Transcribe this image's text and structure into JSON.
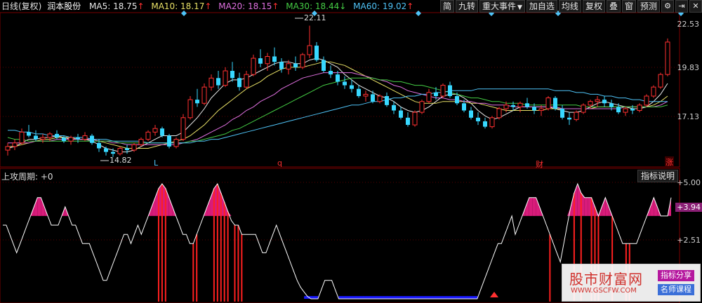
{
  "header": {
    "period_label": "日线(复权)",
    "stock_name": "润本股份",
    "ma": [
      {
        "label": "MA5: 18.75",
        "arrow": "↑",
        "color": "#e8e8e8",
        "arrow_color": "#ff3030"
      },
      {
        "label": "MA10: 18.17",
        "arrow": "↑",
        "color": "#e8e066",
        "arrow_color": "#ff3030"
      },
      {
        "label": "MA20: 18.15",
        "arrow": "↑",
        "color": "#e070e0",
        "arrow_color": "#ff3030"
      },
      {
        "label": "MA30: 18.44",
        "arrow": "↓",
        "color": "#44cc44",
        "arrow_color": "#44cc44"
      },
      {
        "label": "MA60: 19.02",
        "arrow": "↑",
        "color": "#4fc3f7",
        "arrow_color": "#ff3030"
      }
    ]
  },
  "toolbar": {
    "buttons": [
      "简",
      "九转",
      "重大事件",
      "加自选",
      "均线",
      "复权",
      "叠",
      "窗",
      "预测"
    ],
    "dropdown_arrow": "▼",
    "icons": [
      "gear-icon",
      "pin-icon",
      "close-icon"
    ],
    "icon_glyphs": [
      "⚙",
      "⇥",
      "✕"
    ]
  },
  "price_axis": {
    "labels": [
      "22.53",
      "19.83",
      "17.13"
    ],
    "high_annotation": "22.11",
    "low_annotation": "14.82"
  },
  "event_markers": {
    "l": "L",
    "q": "q",
    "cai": "财",
    "zhang": "涨"
  },
  "indicator": {
    "title": "上攻周期: +0",
    "explain_button": "指标说明",
    "axis_labels": [
      "5.00",
      "2.51"
    ],
    "current_value": "3.94"
  },
  "watermark": {
    "title": "股市财富网",
    "url": "WWW.GSCFW.COM",
    "tag1": "指标分享",
    "tag2": "名师课程"
  },
  "chart_data": {
    "type": "candlestick",
    "ylim": [
      14.5,
      22.6
    ],
    "candles": [
      [
        15.2,
        15.6,
        14.9,
        15.4
      ],
      [
        15.4,
        15.8,
        15.2,
        15.6
      ],
      [
        15.6,
        16.4,
        15.5,
        16.2
      ],
      [
        16.2,
        16.6,
        15.9,
        16.0
      ],
      [
        16.0,
        16.3,
        15.7,
        15.8
      ],
      [
        15.8,
        16.1,
        15.6,
        15.9
      ],
      [
        15.9,
        16.2,
        15.7,
        16.1
      ],
      [
        16.1,
        16.3,
        15.8,
        15.9
      ],
      [
        15.9,
        16.0,
        15.6,
        15.7
      ],
      [
        15.7,
        16.0,
        15.5,
        15.9
      ],
      [
        15.9,
        16.1,
        15.6,
        15.8
      ],
      [
        15.8,
        16.2,
        15.7,
        16.0
      ],
      [
        16.0,
        16.1,
        15.5,
        15.6
      ],
      [
        15.6,
        15.8,
        15.1,
        15.3
      ],
      [
        15.3,
        15.4,
        14.9,
        15.1
      ],
      [
        15.1,
        15.3,
        14.82,
        15.0
      ],
      [
        15.0,
        15.4,
        14.9,
        15.3
      ],
      [
        15.3,
        15.5,
        15.0,
        15.2
      ],
      [
        15.2,
        15.6,
        15.1,
        15.5
      ],
      [
        15.5,
        15.9,
        15.4,
        15.8
      ],
      [
        15.8,
        16.3,
        15.7,
        16.2
      ],
      [
        16.2,
        16.6,
        16.0,
        16.4
      ],
      [
        16.4,
        16.5,
        15.9,
        16.0
      ],
      [
        16.0,
        16.1,
        15.3,
        15.4
      ],
      [
        15.4,
        15.9,
        15.3,
        15.8
      ],
      [
        15.8,
        17.2,
        15.7,
        17.0
      ],
      [
        17.0,
        18.2,
        16.9,
        18.0
      ],
      [
        18.0,
        18.6,
        17.6,
        17.8
      ],
      [
        17.8,
        18.9,
        17.7,
        18.7
      ],
      [
        18.7,
        19.4,
        18.5,
        19.2
      ],
      [
        19.2,
        19.6,
        18.6,
        18.8
      ],
      [
        18.8,
        19.8,
        18.7,
        19.6
      ],
      [
        19.6,
        20.1,
        19.0,
        19.2
      ],
      [
        19.2,
        19.5,
        18.5,
        18.7
      ],
      [
        18.7,
        19.6,
        18.6,
        19.4
      ],
      [
        19.4,
        20.5,
        19.3,
        20.3
      ],
      [
        20.3,
        20.8,
        19.8,
        20.0
      ],
      [
        20.0,
        20.6,
        19.6,
        20.4
      ],
      [
        20.4,
        20.9,
        19.9,
        20.1
      ],
      [
        20.1,
        20.3,
        19.5,
        19.7
      ],
      [
        19.7,
        20.2,
        19.4,
        20.0
      ],
      [
        20.0,
        20.4,
        19.6,
        19.8
      ],
      [
        19.8,
        20.6,
        19.7,
        20.5
      ],
      [
        20.5,
        22.11,
        20.3,
        21.0
      ],
      [
        21.0,
        21.2,
        20.1,
        20.2
      ],
      [
        20.2,
        20.4,
        19.5,
        19.6
      ],
      [
        19.6,
        19.9,
        19.2,
        19.4
      ],
      [
        19.4,
        19.6,
        18.8,
        19.0
      ],
      [
        19.0,
        19.3,
        18.6,
        18.8
      ],
      [
        18.8,
        19.1,
        18.4,
        18.6
      ],
      [
        18.6,
        18.8,
        18.1,
        18.2
      ],
      [
        18.2,
        18.5,
        17.9,
        18.3
      ],
      [
        18.3,
        18.5,
        17.8,
        17.9
      ],
      [
        17.9,
        18.3,
        17.8,
        18.2
      ],
      [
        18.2,
        18.4,
        17.6,
        17.7
      ],
      [
        17.7,
        17.9,
        17.2,
        17.4
      ],
      [
        17.4,
        17.6,
        16.9,
        17.0
      ],
      [
        17.0,
        17.3,
        16.5,
        16.6
      ],
      [
        16.6,
        17.4,
        16.5,
        17.3
      ],
      [
        17.3,
        18.0,
        17.2,
        17.9
      ],
      [
        17.9,
        18.6,
        17.8,
        18.4
      ],
      [
        18.4,
        18.7,
        18.0,
        18.2
      ],
      [
        18.2,
        18.9,
        18.1,
        18.8
      ],
      [
        18.8,
        19.0,
        18.1,
        18.2
      ],
      [
        18.2,
        18.4,
        17.7,
        17.8
      ],
      [
        17.8,
        18.0,
        17.3,
        17.4
      ],
      [
        17.4,
        17.6,
        16.9,
        17.0
      ],
      [
        17.0,
        17.3,
        16.6,
        16.8
      ],
      [
        16.8,
        17.0,
        16.4,
        16.5
      ],
      [
        16.5,
        17.1,
        16.4,
        17.0
      ],
      [
        17.0,
        17.6,
        16.9,
        17.5
      ],
      [
        17.5,
        17.9,
        17.3,
        17.7
      ],
      [
        17.7,
        17.9,
        17.4,
        17.6
      ],
      [
        17.6,
        17.9,
        17.3,
        17.8
      ],
      [
        17.8,
        18.1,
        17.5,
        17.6
      ],
      [
        17.6,
        17.8,
        17.2,
        17.4
      ],
      [
        17.4,
        17.7,
        17.1,
        17.5
      ],
      [
        17.5,
        18.2,
        17.4,
        18.1
      ],
      [
        18.1,
        18.2,
        17.4,
        17.5
      ],
      [
        17.5,
        17.7,
        16.9,
        17.0
      ],
      [
        17.0,
        17.3,
        16.6,
        16.9
      ],
      [
        16.9,
        17.4,
        16.8,
        17.3
      ],
      [
        17.3,
        17.8,
        17.2,
        17.7
      ],
      [
        17.7,
        18.0,
        17.5,
        17.9
      ],
      [
        17.9,
        18.2,
        17.6,
        18.0
      ],
      [
        18.0,
        18.2,
        17.6,
        17.8
      ],
      [
        17.8,
        18.0,
        17.4,
        17.6
      ],
      [
        17.6,
        17.8,
        17.2,
        17.3
      ],
      [
        17.3,
        17.6,
        17.1,
        17.5
      ],
      [
        17.5,
        17.7,
        17.2,
        17.4
      ],
      [
        17.4,
        17.8,
        17.3,
        17.7
      ],
      [
        17.7,
        18.3,
        17.6,
        18.2
      ],
      [
        18.2,
        18.8,
        18.1,
        18.7
      ],
      [
        18.7,
        19.5,
        18.6,
        19.4
      ],
      [
        19.4,
        21.4,
        19.3,
        21.2
      ]
    ],
    "ma_lines": [
      {
        "name": "MA5",
        "color": "#e8e8e8",
        "values": [
          15.3,
          15.4,
          15.6,
          15.8,
          15.8,
          15.9,
          15.9,
          16.0,
          15.9,
          15.8,
          15.8,
          15.8,
          15.7,
          15.5,
          15.3,
          15.2,
          15.1,
          15.1,
          15.2,
          15.4,
          15.6,
          15.8,
          16.0,
          16.0,
          16.0,
          16.2,
          16.6,
          17.0,
          17.5,
          18.1,
          18.5,
          18.9,
          19.1,
          19.1,
          19.2,
          19.4,
          19.6,
          19.8,
          20.0,
          20.1,
          20.1,
          20.0,
          20.0,
          20.2,
          20.3,
          20.2,
          20.0,
          19.8,
          19.4,
          19.1,
          18.8,
          18.6,
          18.4,
          18.2,
          18.1,
          17.9,
          17.6,
          17.4,
          17.3,
          17.4,
          17.6,
          17.9,
          18.2,
          18.3,
          18.3,
          18.1,
          17.8,
          17.4,
          17.1,
          16.9,
          17.0,
          17.2,
          17.4,
          17.6,
          17.6,
          17.6,
          17.6,
          17.6,
          17.5,
          17.4,
          17.3,
          17.3,
          17.4,
          17.6,
          17.8,
          17.9,
          17.8,
          17.7,
          17.6,
          17.5,
          17.5,
          17.6,
          17.9,
          18.3,
          18.9
        ]
      },
      {
        "name": "MA10",
        "color": "#e8e066",
        "values": [
          15.4,
          15.4,
          15.5,
          15.6,
          15.7,
          15.8,
          15.8,
          15.9,
          15.9,
          15.9,
          15.8,
          15.8,
          15.8,
          15.7,
          15.6,
          15.5,
          15.4,
          15.3,
          15.3,
          15.3,
          15.3,
          15.4,
          15.5,
          15.6,
          15.7,
          15.8,
          16.0,
          16.3,
          16.6,
          17.0,
          17.4,
          17.7,
          18.0,
          18.3,
          18.6,
          18.8,
          19.0,
          19.3,
          19.5,
          19.7,
          19.8,
          19.8,
          19.8,
          19.9,
          20.0,
          20.1,
          20.1,
          20.0,
          19.9,
          19.7,
          19.5,
          19.3,
          19.1,
          18.9,
          18.7,
          18.5,
          18.3,
          18.1,
          17.9,
          17.8,
          17.8,
          17.8,
          17.9,
          17.9,
          17.9,
          17.9,
          17.8,
          17.8,
          17.7,
          17.6,
          17.5,
          17.4,
          17.4,
          17.4,
          17.4,
          17.4,
          17.4,
          17.5,
          17.5,
          17.5,
          17.5,
          17.5,
          17.5,
          17.5,
          17.6,
          17.6,
          17.6,
          17.6,
          17.6,
          17.6,
          17.6,
          17.6,
          17.7,
          17.9,
          18.2
        ]
      },
      {
        "name": "MA20",
        "color": "#e070e0",
        "values": [
          15.6,
          15.6,
          15.6,
          15.6,
          15.7,
          15.7,
          15.7,
          15.8,
          15.8,
          15.8,
          15.8,
          15.8,
          15.8,
          15.7,
          15.7,
          15.6,
          15.6,
          15.5,
          15.5,
          15.5,
          15.5,
          15.5,
          15.5,
          15.5,
          15.5,
          15.6,
          15.7,
          15.8,
          16.0,
          16.2,
          16.4,
          16.6,
          16.9,
          17.1,
          17.4,
          17.6,
          17.9,
          18.1,
          18.3,
          18.6,
          18.8,
          19.0,
          19.2,
          19.3,
          19.4,
          19.5,
          19.5,
          19.5,
          19.5,
          19.5,
          19.4,
          19.3,
          19.2,
          19.1,
          19.0,
          18.8,
          18.7,
          18.5,
          18.4,
          18.3,
          18.2,
          18.1,
          18.1,
          18.0,
          18.0,
          17.9,
          17.9,
          17.8,
          17.8,
          17.7,
          17.7,
          17.7,
          17.6,
          17.6,
          17.6,
          17.6,
          17.6,
          17.6,
          17.6,
          17.5,
          17.5,
          17.5,
          17.5,
          17.5,
          17.5,
          17.5,
          17.5,
          17.5,
          17.6,
          17.6,
          17.6,
          17.6,
          17.6,
          17.7,
          17.9
        ]
      },
      {
        "name": "MA30",
        "color": "#44cc44",
        "values": [
          15.9,
          15.8,
          15.8,
          15.7,
          15.7,
          15.7,
          15.7,
          15.7,
          15.7,
          15.7,
          15.7,
          15.7,
          15.7,
          15.7,
          15.7,
          15.7,
          15.6,
          15.6,
          15.6,
          15.6,
          15.6,
          15.6,
          15.6,
          15.6,
          15.6,
          15.6,
          15.7,
          15.7,
          15.8,
          15.9,
          16.0,
          16.1,
          16.3,
          16.4,
          16.6,
          16.8,
          17.0,
          17.2,
          17.4,
          17.6,
          17.8,
          18.0,
          18.2,
          18.4,
          18.6,
          18.8,
          18.9,
          19.0,
          19.1,
          19.2,
          19.2,
          19.2,
          19.2,
          19.1,
          19.1,
          19.0,
          19.0,
          18.9,
          18.8,
          18.8,
          18.7,
          18.6,
          18.5,
          18.4,
          18.3,
          18.2,
          18.1,
          18.1,
          18.0,
          17.9,
          17.9,
          17.8,
          17.8,
          17.8,
          17.7,
          17.7,
          17.7,
          17.7,
          17.7,
          17.7,
          17.7,
          17.7,
          17.6,
          17.6,
          17.6,
          17.6,
          17.6,
          17.6,
          17.6,
          17.6,
          17.6,
          17.6,
          17.6,
          17.6,
          17.7
        ]
      },
      {
        "name": "MA60",
        "color": "#4fc3f7",
        "values": [
          16.3,
          16.3,
          16.2,
          16.2,
          16.1,
          16.1,
          16.0,
          16.0,
          16.0,
          15.9,
          15.9,
          15.9,
          15.8,
          15.8,
          15.8,
          15.7,
          15.7,
          15.7,
          15.7,
          15.7,
          15.6,
          15.6,
          15.6,
          15.6,
          15.6,
          15.6,
          15.6,
          15.7,
          15.7,
          15.8,
          15.8,
          15.9,
          16.0,
          16.1,
          16.2,
          16.3,
          16.4,
          16.5,
          16.6,
          16.7,
          16.8,
          16.9,
          17.0,
          17.1,
          17.2,
          17.3,
          17.4,
          17.5,
          17.6,
          17.7,
          17.7,
          17.8,
          17.9,
          17.9,
          18.0,
          18.1,
          18.1,
          18.2,
          18.2,
          18.3,
          18.3,
          18.4,
          18.4,
          18.5,
          18.5,
          18.5,
          18.5,
          18.6,
          18.6,
          18.6,
          18.6,
          18.6,
          18.6,
          18.6,
          18.6,
          18.6,
          18.6,
          18.6,
          18.5,
          18.5,
          18.5,
          18.4,
          18.4,
          18.3,
          18.3,
          18.2,
          18.2,
          18.1,
          18.1,
          18.0,
          18.0,
          17.9,
          17.9,
          17.9,
          17.9
        ]
      }
    ],
    "indicator_line": [
      3.2,
      3.2,
      2.8,
      2.4,
      2.0,
      2.4,
      2.8,
      3.2,
      3.6,
      4.0,
      4.4,
      4.4,
      4.0,
      3.6,
      3.2,
      3.2,
      3.2,
      3.6,
      4.0,
      3.6,
      3.2,
      3.2,
      2.8,
      2.4,
      2.4,
      2.4,
      2.0,
      1.6,
      1.2,
      0.8,
      0.8,
      1.2,
      1.6,
      2.0,
      2.4,
      2.8,
      2.8,
      2.4,
      2.8,
      3.2,
      2.8,
      3.2,
      3.6,
      4.0,
      4.4,
      4.8,
      5.0,
      4.8,
      4.4,
      4.0,
      3.6,
      3.2,
      2.8,
      2.8,
      2.4,
      2.4,
      2.8,
      3.2,
      3.6,
      4.0,
      4.4,
      4.8,
      5.0,
      4.6,
      4.2,
      3.8,
      3.4,
      3.2,
      3.2,
      2.8,
      2.8,
      2.8,
      2.8,
      2.8,
      2.4,
      2.0,
      2.0,
      2.4,
      2.8,
      3.2,
      2.8,
      2.4,
      2.0,
      1.6,
      1.2,
      0.8,
      0.5,
      0.3,
      0.1,
      0.0,
      0.0,
      0.0,
      0.4,
      0.8,
      0.8,
      0.8,
      0.4,
      0.0,
      0.0,
      0.0,
      0.0,
      0.0,
      0.0,
      0.0,
      0.0,
      0.0,
      0.0,
      0.0,
      0.0,
      0.0,
      0.0,
      0.0,
      0.0,
      0.0,
      0.0,
      0.0,
      0.0,
      0.0,
      0.0,
      0.0,
      0.0,
      0.0,
      0.0,
      0.0,
      0.0,
      0.0,
      0.0,
      0.0,
      0.0,
      0.0,
      0.0,
      0.0,
      0.0,
      0.0,
      0.0,
      0.0,
      0.0,
      0.0,
      0.4,
      0.8,
      1.2,
      1.6,
      2.0,
      2.4,
      2.4,
      2.8,
      3.2,
      3.6,
      2.8,
      3.2,
      3.6,
      4.0,
      4.4,
      4.4,
      4.4,
      4.0,
      3.6,
      3.2,
      2.8,
      2.4,
      2.0,
      1.6,
      2.4,
      3.2,
      4.0,
      4.6,
      5.0,
      4.6,
      4.4,
      4.4,
      4.4,
      4.0,
      3.6,
      4.0,
      4.4,
      4.0,
      3.6,
      3.2,
      2.8,
      2.4,
      2.4,
      2.4,
      2.4,
      2.4,
      2.8,
      3.2,
      3.6,
      4.0,
      4.4,
      4.0,
      3.6,
      3.6,
      3.6,
      4.4
    ],
    "indicator_ylim": [
      0,
      5
    ],
    "pink_threshold": 3.6,
    "blue_threshold": 0.3,
    "red_bar_indices": [
      44,
      45,
      46,
      54,
      55,
      60,
      61,
      62,
      63,
      64,
      66,
      67,
      68,
      156,
      162,
      164,
      167,
      168,
      169,
      173,
      177,
      178
    ]
  },
  "colors": {
    "up": "#ff3030",
    "down": "#38d8ff",
    "pink": "#d81b7a",
    "blue": "#1a1aff",
    "grid": "#3a0000"
  }
}
